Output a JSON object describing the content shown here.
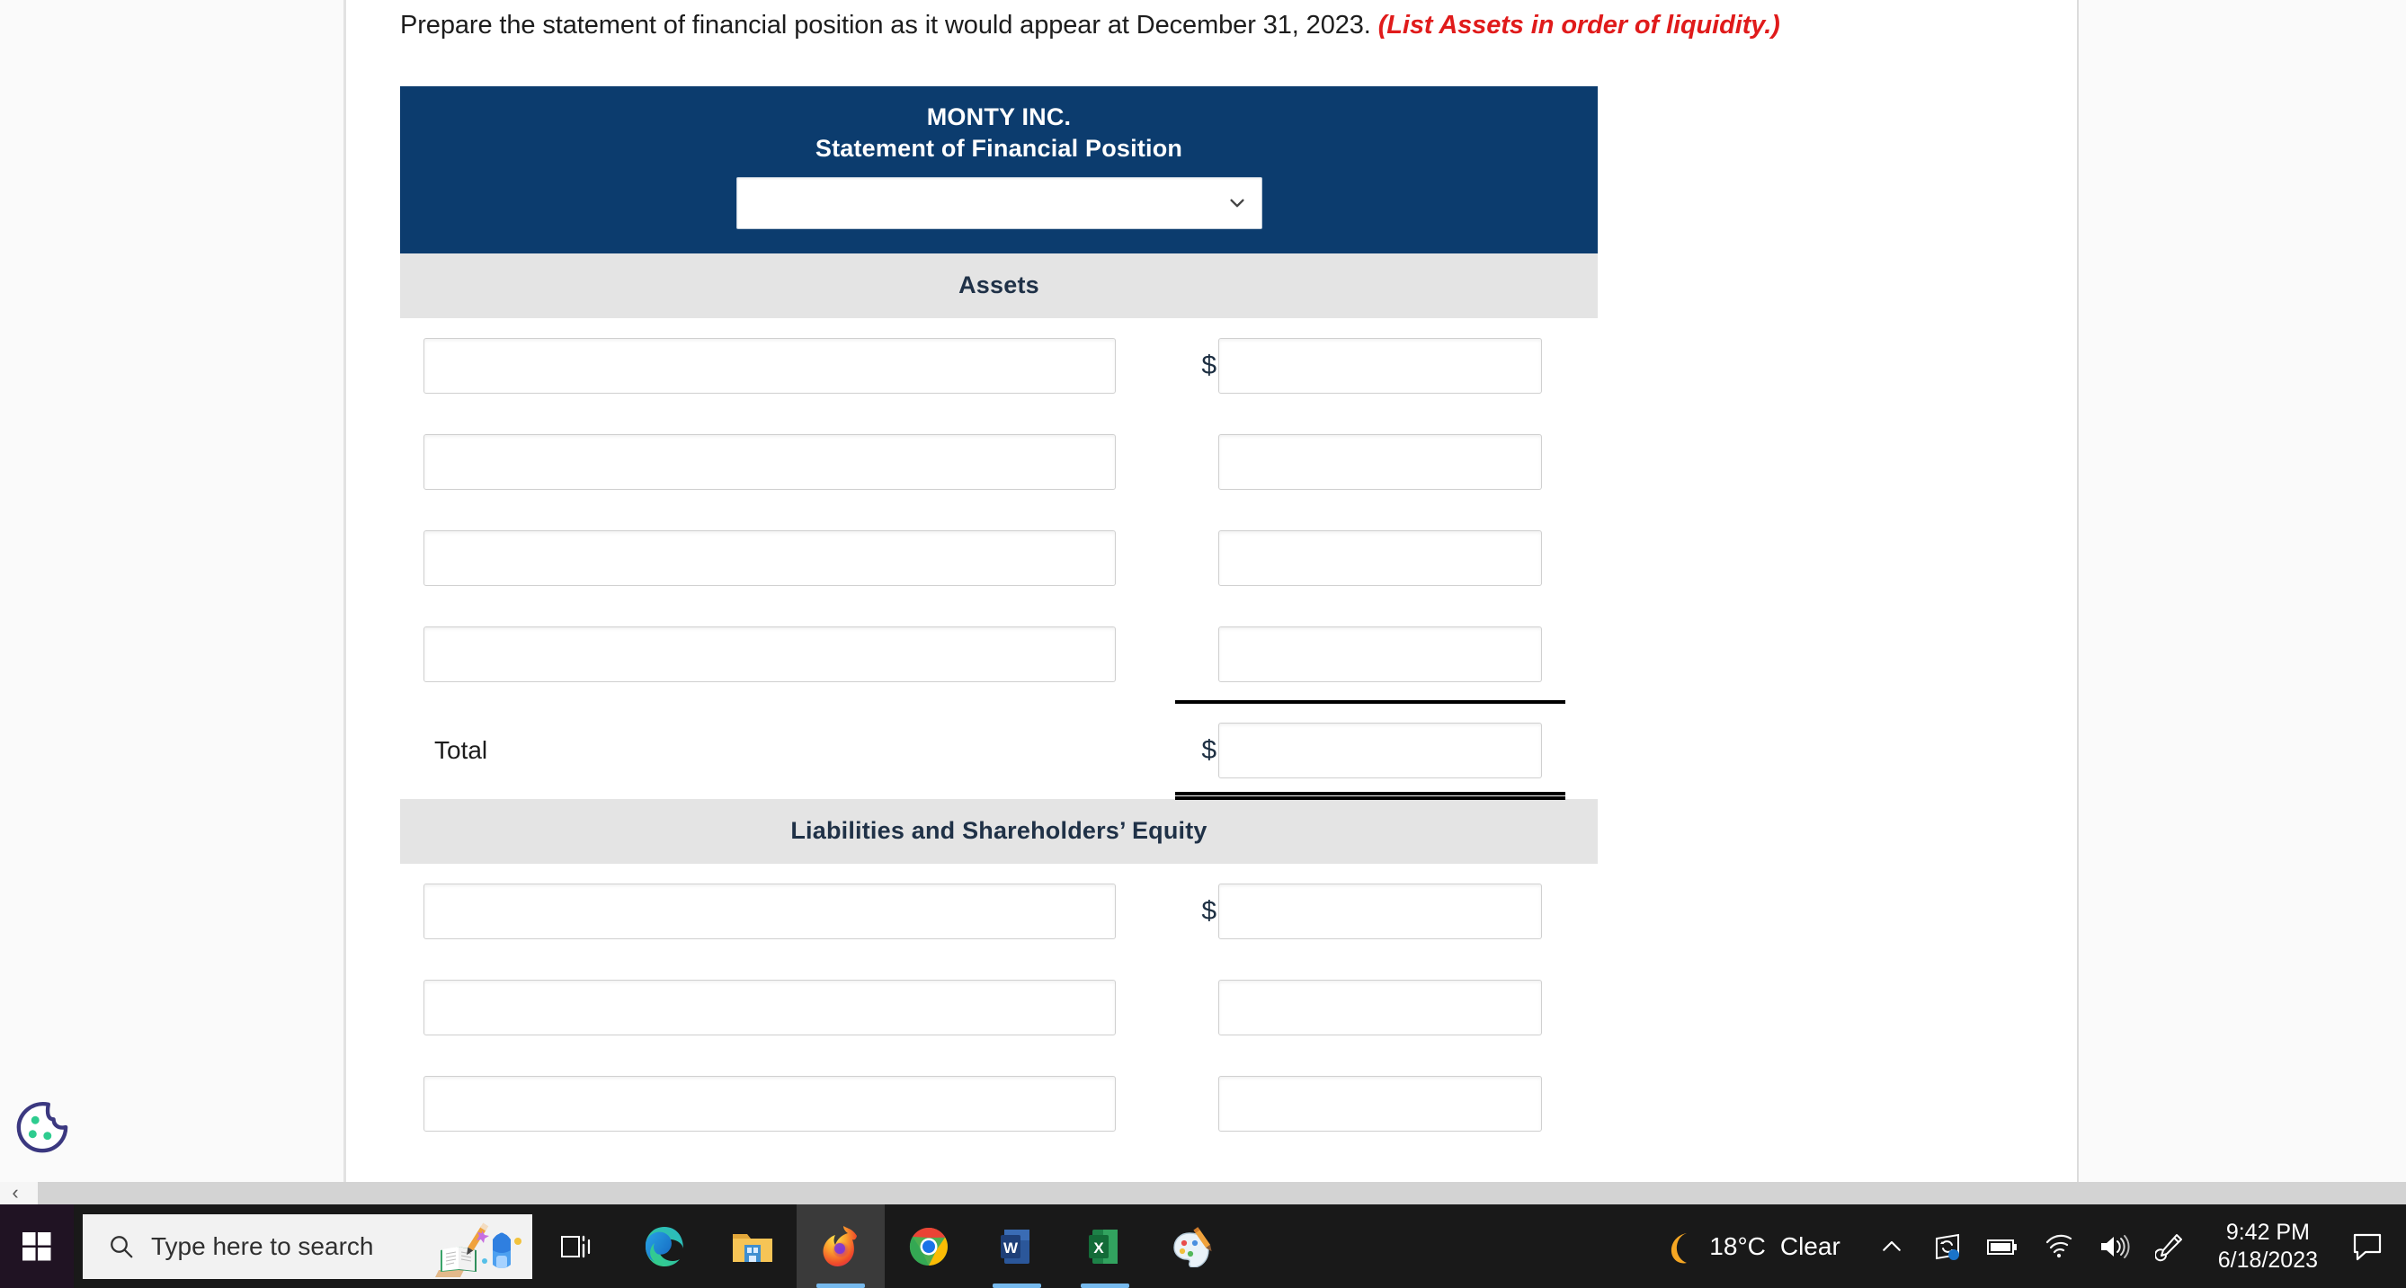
{
  "prompt": {
    "text": "Prepare the statement of financial position as it would appear at December 31, 2023. ",
    "hint": "(List Assets in order of liquidity.)"
  },
  "statement": {
    "company": "MONTY INC.",
    "subtitle": "Statement of Financial Position",
    "date_select": {
      "value": "",
      "icon": "chevron-down-icon"
    },
    "assets": {
      "band_label": "Assets",
      "rows": [
        {
          "label": "",
          "amount": "",
          "dollar": "$"
        },
        {
          "label": "",
          "amount": "",
          "dollar": ""
        },
        {
          "label": "",
          "amount": "",
          "dollar": ""
        },
        {
          "label": "",
          "amount": "",
          "dollar": ""
        }
      ],
      "total": {
        "label": "Total",
        "amount": "",
        "dollar": "$"
      }
    },
    "liabilities": {
      "band_label": "Liabilities and Shareholders’ Equity",
      "rows": [
        {
          "label": "",
          "amount": "",
          "dollar": "$"
        },
        {
          "label": "",
          "amount": "",
          "dollar": ""
        },
        {
          "label": "",
          "amount": "",
          "dollar": ""
        }
      ]
    }
  },
  "cookie_widget": {
    "icon": "cookie-icon"
  },
  "scroll_strip": {
    "back_icon": "chevron-left-icon"
  },
  "taskbar": {
    "start": {
      "icon": "windows-start-icon"
    },
    "search": {
      "placeholder": "Type here to search",
      "icon": "search-icon"
    },
    "apps": [
      {
        "name": "task-view",
        "icon": "task-view-icon",
        "active": false,
        "running": false
      },
      {
        "name": "microsoft-edge",
        "icon": "edge-icon",
        "active": false,
        "running": false
      },
      {
        "name": "file-explorer",
        "icon": "file-explorer-icon",
        "active": false,
        "running": false
      },
      {
        "name": "firefox",
        "icon": "firefox-icon",
        "active": true,
        "running": true
      },
      {
        "name": "google-chrome",
        "icon": "chrome-icon",
        "active": false,
        "running": false
      },
      {
        "name": "microsoft-word",
        "icon": "word-icon",
        "active": false,
        "running": true
      },
      {
        "name": "microsoft-excel",
        "icon": "excel-icon",
        "active": false,
        "running": true
      },
      {
        "name": "paint-3d",
        "icon": "paint-icon",
        "active": false,
        "running": false
      }
    ],
    "tray": {
      "weather": {
        "icon": "moon-icon",
        "temperature": "18°C",
        "condition": "Clear"
      },
      "icons": [
        {
          "name": "show-hidden-icons",
          "icon": "chevron-up-icon"
        },
        {
          "name": "onedrive",
          "icon": "onedrive-sync-icon"
        },
        {
          "name": "battery",
          "icon": "battery-icon"
        },
        {
          "name": "network",
          "icon": "wifi-icon"
        },
        {
          "name": "volume",
          "icon": "speaker-icon"
        },
        {
          "name": "pen-tool",
          "icon": "pen-icon"
        }
      ],
      "clock": {
        "time": "9:42 PM",
        "date": "6/18/2023"
      },
      "action_center": {
        "icon": "speech-bubble-icon"
      }
    }
  },
  "colors": {
    "header_navy": "#0c3c6e",
    "band_gray": "#e4e4e4",
    "hint_red": "#e01b1b",
    "taskbar": "#191919"
  }
}
